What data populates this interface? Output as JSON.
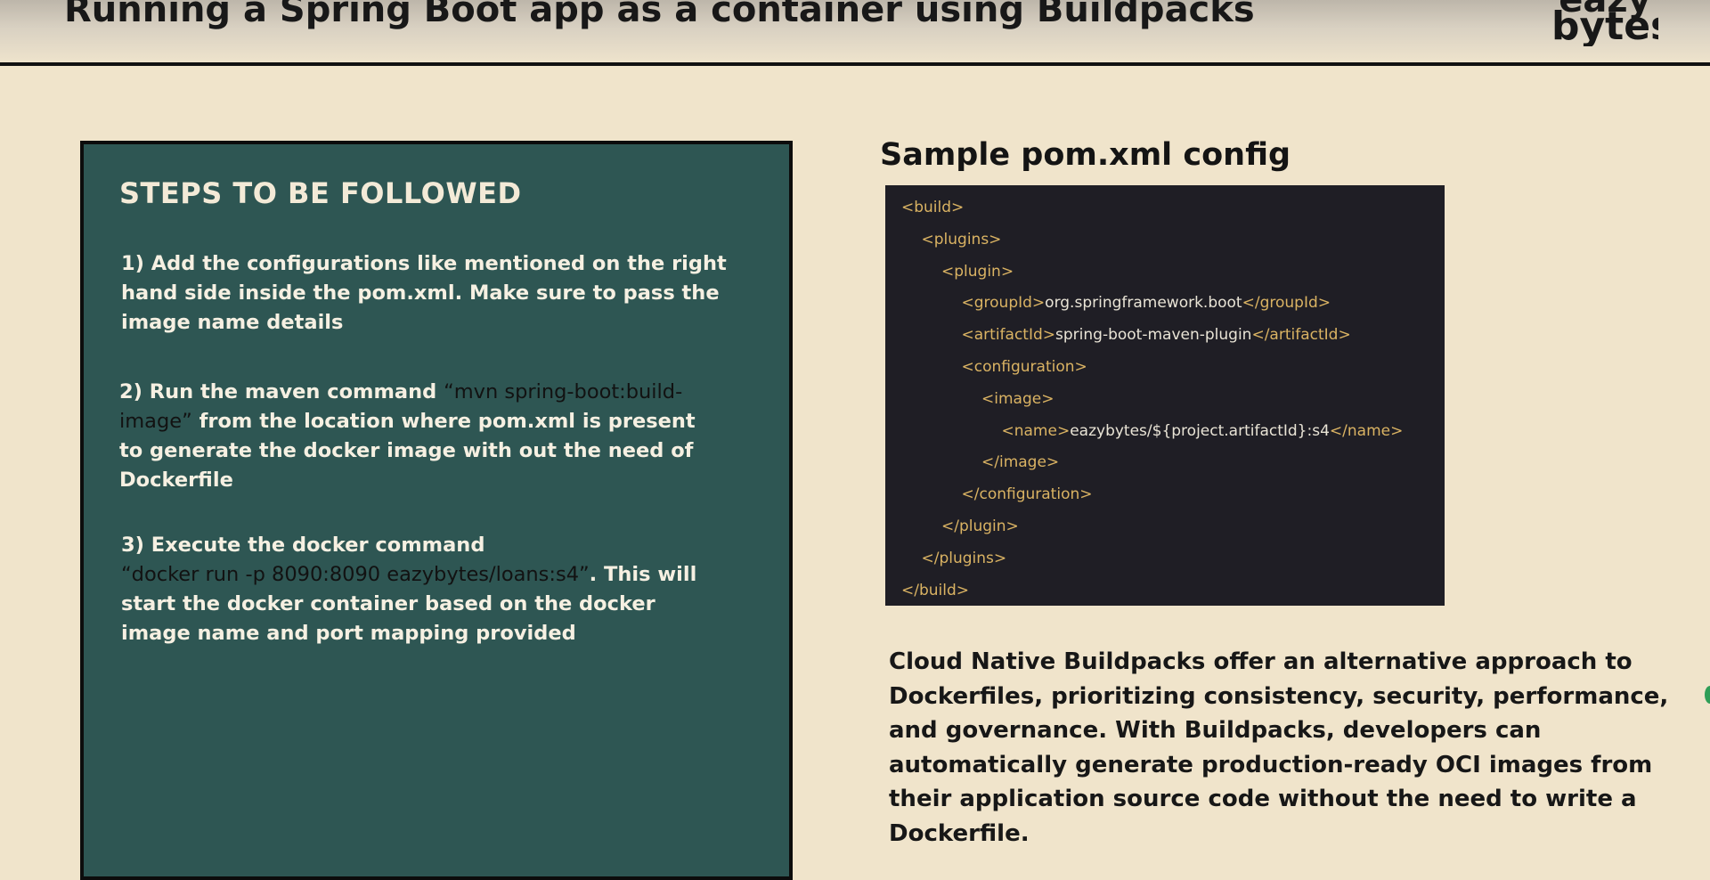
{
  "header": {
    "title": "Running a Spring Boot app as a container using Buildpacks",
    "logo_line1": "eazy",
    "logo_line2": "bytes"
  },
  "steps_panel": {
    "heading": "STEPS TO BE FOLLOWED",
    "steps": [
      {
        "text_before": "1) Add the configurations like mentioned on the right hand side inside the pom.xml. Make sure to pass the image name details",
        "command": "",
        "text_after": ""
      },
      {
        "text_before": "2) Run the maven command ",
        "command": "“mvn spring-boot:build-image”",
        "text_after": " from the location where pom.xml is present to generate the docker image with out the need of Dockerfile"
      },
      {
        "text_before": "3) Execute the docker command ",
        "command": "“docker run -p 8090:8090 eazybytes/loans:s4”",
        "text_after": ". This will start the docker container based on the docker image name and port mapping provided"
      }
    ]
  },
  "pom_section": {
    "heading": "Sample pom.xml config",
    "code_lines": [
      {
        "indent": 0,
        "open_tag": "<build>",
        "value": "",
        "close_tag": ""
      },
      {
        "indent": 1,
        "open_tag": "<plugins>",
        "value": "",
        "close_tag": ""
      },
      {
        "indent": 2,
        "open_tag": "<plugin>",
        "value": "",
        "close_tag": ""
      },
      {
        "indent": 3,
        "open_tag": "<groupId>",
        "value": "org.springframework.boot",
        "close_tag": "</groupId>"
      },
      {
        "indent": 3,
        "open_tag": "<artifactId>",
        "value": "spring-boot-maven-plugin",
        "close_tag": "</artifactId>"
      },
      {
        "indent": 3,
        "open_tag": "<configuration>",
        "value": "",
        "close_tag": ""
      },
      {
        "indent": 4,
        "open_tag": "<image>",
        "value": "",
        "close_tag": ""
      },
      {
        "indent": 5,
        "open_tag": "<name>",
        "value": "eazybytes/${project.artifactId}:s4",
        "close_tag": "</name>"
      },
      {
        "indent": 4,
        "open_tag": "</image>",
        "value": "",
        "close_tag": ""
      },
      {
        "indent": 3,
        "open_tag": "</configuration>",
        "value": "",
        "close_tag": ""
      },
      {
        "indent": 2,
        "open_tag": "</plugin>",
        "value": "",
        "close_tag": ""
      },
      {
        "indent": 1,
        "open_tag": "</plugins>",
        "value": "",
        "close_tag": ""
      },
      {
        "indent": 0,
        "open_tag": "</build>",
        "value": "",
        "close_tag": ""
      }
    ]
  },
  "description": "Cloud Native Buildpacks offer an alternative approach to Dockerfiles, prioritizing consistency, security, performance, and governance. With Buildpacks, developers can automatically generate production-ready OCI images from their application source code without the need to write a Dockerfile.",
  "colors": {
    "background": "#f0e4cb",
    "panel": "#2e5653",
    "code_background": "#1f1e25",
    "code_tag": "#dab363",
    "code_value": "#e9e4d6"
  }
}
